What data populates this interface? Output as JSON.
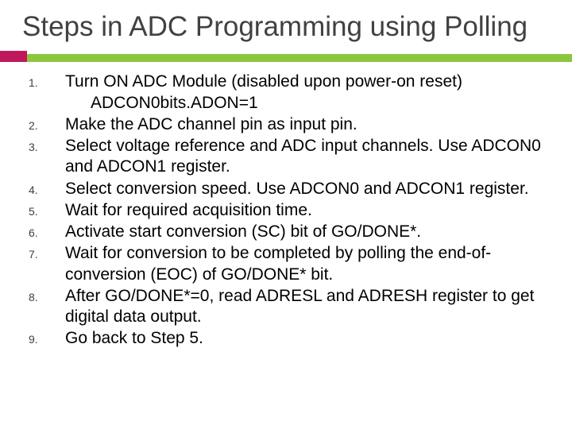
{
  "title": "Steps in ADC Programming using Polling",
  "steps": {
    "s1a": "Turn ON ADC Module (disabled upon power-on reset)",
    "s1b": "ADCON0bits.ADON=1",
    "s2": "Make  the ADC channel pin as input pin.",
    "s3": "Select voltage reference and ADC input channels. Use ADCON0 and ADCON1 register.",
    "s4": "Select conversion speed. Use ADCON0 and ADCON1 register.",
    "s5": "Wait for required acquisition time.",
    "s6": "Activate start conversion (SC) bit of GO/DONE*.",
    "s7": "Wait for conversion to be completed by polling the end-of-conversion (EOC) of GO/DONE* bit.",
    "s8": "After GO/DONE*=0, read ADRESL and ADRESH register to get digital data output.",
    "s9": "Go back to Step 5."
  }
}
